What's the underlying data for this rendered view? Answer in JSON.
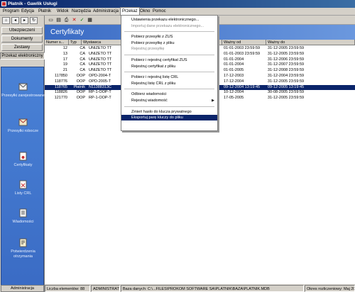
{
  "window": {
    "title": "Płatnik - Gawlik Usługi"
  },
  "menu": [
    "Program",
    "Edycja",
    "Płatnik",
    "Widok",
    "Narzędzia",
    "Administracja",
    "Przekaz",
    "Okno",
    "Pomoc"
  ],
  "menu_active": "Przekaz",
  "left_nav": {
    "buttons": [
      "Ubezpieczeni",
      "Dokumenty",
      "Zestawy",
      "Przekaz elektroniczny"
    ],
    "items": [
      "Przesyłki zarejestrowane",
      "Przesyłki robocze",
      "Certyfikaty",
      "Listy CRL",
      "Wiadomości",
      "Potwierdzenia otrzymania"
    ],
    "bottom": "Administracja"
  },
  "header": {
    "title": "Certyfikaty"
  },
  "table": {
    "columns": [
      "Numer s...",
      "Typ",
      "Wystawca",
      "Ważny od",
      "Ważny do"
    ],
    "rows": [
      {
        "num": "12",
        "typ": "CA",
        "wyst": "UNIZETO TT",
        "od": "01-01-2003 23:59:59",
        "do": "31-12-2005 23:59:59"
      },
      {
        "num": "13",
        "typ": "CA",
        "wyst": "UNIZETO TT",
        "od": "01-01-2003 23:59:59",
        "do": "31-12-2005 23:59:59"
      },
      {
        "num": "17",
        "typ": "CA",
        "wyst": "UNIZETO TT",
        "od": "01-01-2004",
        "do": "31-12-2006 23:59:59"
      },
      {
        "num": "19",
        "typ": "CA",
        "wyst": "UNIZETO TT",
        "od": "01-01-2004",
        "do": "31-12-2007 23:59:59"
      },
      {
        "num": "21",
        "typ": "CA",
        "wyst": "UNIZETO TT",
        "od": "01-01-2005",
        "do": "31-12-2008 23:59:59"
      },
      {
        "num": "117850",
        "typ": "OOP",
        "wyst": "OPD-2004-T",
        "od": "17-12-2003",
        "do": "31-12-2004 23:59:59"
      },
      {
        "num": "118776",
        "typ": "OOP",
        "wyst": "OPD-2005-T",
        "od": "17-12-2004",
        "do": "31-12-2005 23:59:59"
      },
      {
        "num": "118765",
        "typ": "Płatnik",
        "wyst": "N11388313C",
        "od": "09-12-2004 13:19:45",
        "do": "09-12-2005 13:19:45"
      },
      {
        "num": "118826",
        "typ": "OOP",
        "wyst": "RP-1-OOP-T",
        "od": "10-12-2004",
        "do": "30-08-2005 23:59:59"
      },
      {
        "num": "121770",
        "typ": "OOP",
        "wyst": "RP-1-OOP-T",
        "od": "17-05-2005",
        "do": "31-12-2005 23:59:59"
      }
    ],
    "selected_row": 7
  },
  "przekaz_menu": [
    {
      "label": "Ustawienia przekazu elektronicznego...",
      "disabled": false
    },
    {
      "label": "Importuj dane przekazu elektronicznego...",
      "disabled": true
    },
    {
      "sep": true
    },
    {
      "label": "Pobierz przesyłki z ZUS",
      "disabled": false
    },
    {
      "label": "Pobierz przesyłkę z pliku",
      "disabled": false
    },
    {
      "label": "Rejestruj przesyłkę",
      "disabled": true
    },
    {
      "sep": true
    },
    {
      "label": "Pobierz i rejestruj certyfikat ZUS",
      "disabled": false
    },
    {
      "label": "Rejestruj certyfikat z pliku",
      "disabled": false
    },
    {
      "sep": true
    },
    {
      "label": "Pobierz i rejestruj listę CRL",
      "disabled": false
    },
    {
      "label": "Rejestruj listę CRL z pliku",
      "disabled": false
    },
    {
      "sep": true
    },
    {
      "label": "Odbierz wiadomości",
      "disabled": false
    },
    {
      "label": "Rejestruj wiadomość",
      "disabled": false,
      "submenu": true
    },
    {
      "sep": true
    },
    {
      "label": "Zmień hasło do klucza prywatnego",
      "disabled": false
    },
    {
      "label": "Eksportuj parę kluczy do pliku",
      "disabled": false,
      "highlighted": true
    }
  ],
  "status": {
    "count": "Liczba elementów: 88",
    "user": "ADMINISTRATOR",
    "db": "Baza danych: C:\\...FILES\\PROKOM SOFTWARE SA\\PLATNIK\\BAZA\\PLATNIK.MDB",
    "period": "Okres rozliczeniowy: Maj 2005"
  },
  "colors": {
    "selection": "#0a246a",
    "nav_panel": "#4a82d6",
    "chrome": "#d4d0c8"
  }
}
